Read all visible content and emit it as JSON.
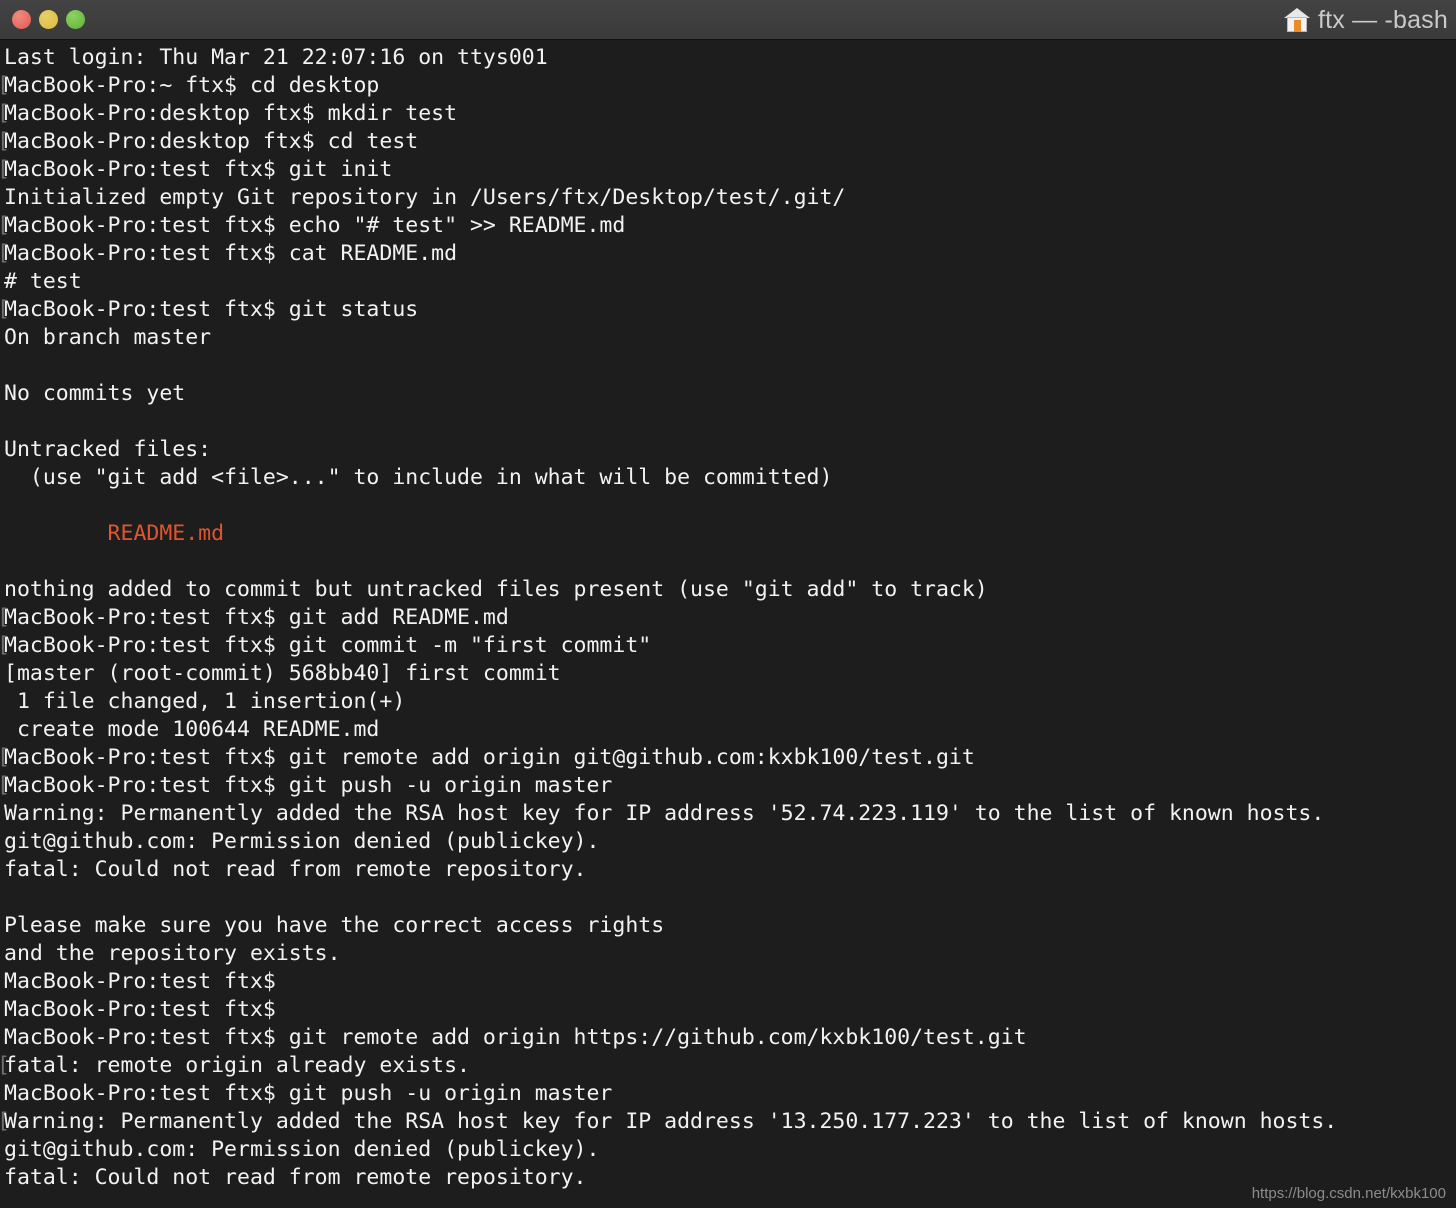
{
  "window": {
    "title": "ftx — -bash",
    "home_icon": "home-icon",
    "traffic_lights": [
      {
        "name": "close",
        "color": "#e3594f"
      },
      {
        "name": "minimize",
        "color": "#dcbb3c"
      },
      {
        "name": "zoom",
        "color": "#5fb534"
      }
    ],
    "titlebar_color": "#3f3f3f"
  },
  "terminal": {
    "background": "#1d1d1d",
    "foreground": "#f2f2f2",
    "untracked_color": "#e0552f",
    "prompt_bracket_color": "#6f6f6f",
    "lines": [
      {
        "text": "Last login: Thu Mar 21 22:07:16 on ttys001",
        "prompt": false
      },
      {
        "text": "MacBook-Pro:~ ftx$ cd desktop",
        "prompt": true
      },
      {
        "text": "MacBook-Pro:desktop ftx$ mkdir test",
        "prompt": true
      },
      {
        "text": "MacBook-Pro:desktop ftx$ cd test",
        "prompt": true
      },
      {
        "text": "MacBook-Pro:test ftx$ git init",
        "prompt": true
      },
      {
        "text": "Initialized empty Git repository in /Users/ftx/Desktop/test/.git/",
        "prompt": false
      },
      {
        "text": "MacBook-Pro:test ftx$ echo \"# test\" >> README.md",
        "prompt": true
      },
      {
        "text": "MacBook-Pro:test ftx$ cat README.md",
        "prompt": true
      },
      {
        "text": "# test",
        "prompt": false
      },
      {
        "text": "MacBook-Pro:test ftx$ git status",
        "prompt": true
      },
      {
        "text": "On branch master",
        "prompt": false
      },
      {
        "text": "",
        "prompt": false
      },
      {
        "text": "No commits yet",
        "prompt": false
      },
      {
        "text": "",
        "prompt": false
      },
      {
        "text": "Untracked files:",
        "prompt": false
      },
      {
        "text": "  (use \"git add <file>...\" to include in what will be committed)",
        "prompt": false
      },
      {
        "text": "",
        "prompt": false
      },
      {
        "text": "        README.md",
        "prompt": false,
        "style": "untracked"
      },
      {
        "text": "",
        "prompt": false
      },
      {
        "text": "nothing added to commit but untracked files present (use \"git add\" to track)",
        "prompt": false
      },
      {
        "text": "MacBook-Pro:test ftx$ git add README.md",
        "prompt": true
      },
      {
        "text": "MacBook-Pro:test ftx$ git commit -m \"first commit\"",
        "prompt": true
      },
      {
        "text": "[master (root-commit) 568bb40] first commit",
        "prompt": false
      },
      {
        "text": " 1 file changed, 1 insertion(+)",
        "prompt": false
      },
      {
        "text": " create mode 100644 README.md",
        "prompt": false
      },
      {
        "text": "MacBook-Pro:test ftx$ git remote add origin git@github.com:kxbk100/test.git",
        "prompt": true
      },
      {
        "text": "MacBook-Pro:test ftx$ git push -u origin master",
        "prompt": true
      },
      {
        "text": "Warning: Permanently added the RSA host key for IP address '52.74.223.119' to the list of known hosts.",
        "prompt": false
      },
      {
        "text": "git@github.com: Permission denied (publickey).",
        "prompt": false
      },
      {
        "text": "fatal: Could not read from remote repository.",
        "prompt": false
      },
      {
        "text": "",
        "prompt": false
      },
      {
        "text": "Please make sure you have the correct access rights",
        "prompt": false
      },
      {
        "text": "and the repository exists.",
        "prompt": false
      },
      {
        "text": "MacBook-Pro:test ftx$ ",
        "prompt": false
      },
      {
        "text": "MacBook-Pro:test ftx$ ",
        "prompt": false
      },
      {
        "text": "MacBook-Pro:test ftx$ git remote add origin https://github.com/kxbk100/test.git",
        "prompt": false
      },
      {
        "text": "fatal: remote origin already exists.",
        "prompt": true
      },
      {
        "text": "MacBook-Pro:test ftx$ git push -u origin master",
        "prompt": false
      },
      {
        "text": "Warning: Permanently added the RSA host key for IP address '13.250.177.223' to the list of known hosts.",
        "prompt": true
      },
      {
        "text": "git@github.com: Permission denied (publickey).",
        "prompt": false
      },
      {
        "text": "fatal: Could not read from remote repository.",
        "prompt": false
      }
    ]
  },
  "watermark": {
    "text": "https://blog.csdn.net/kxbk100"
  }
}
